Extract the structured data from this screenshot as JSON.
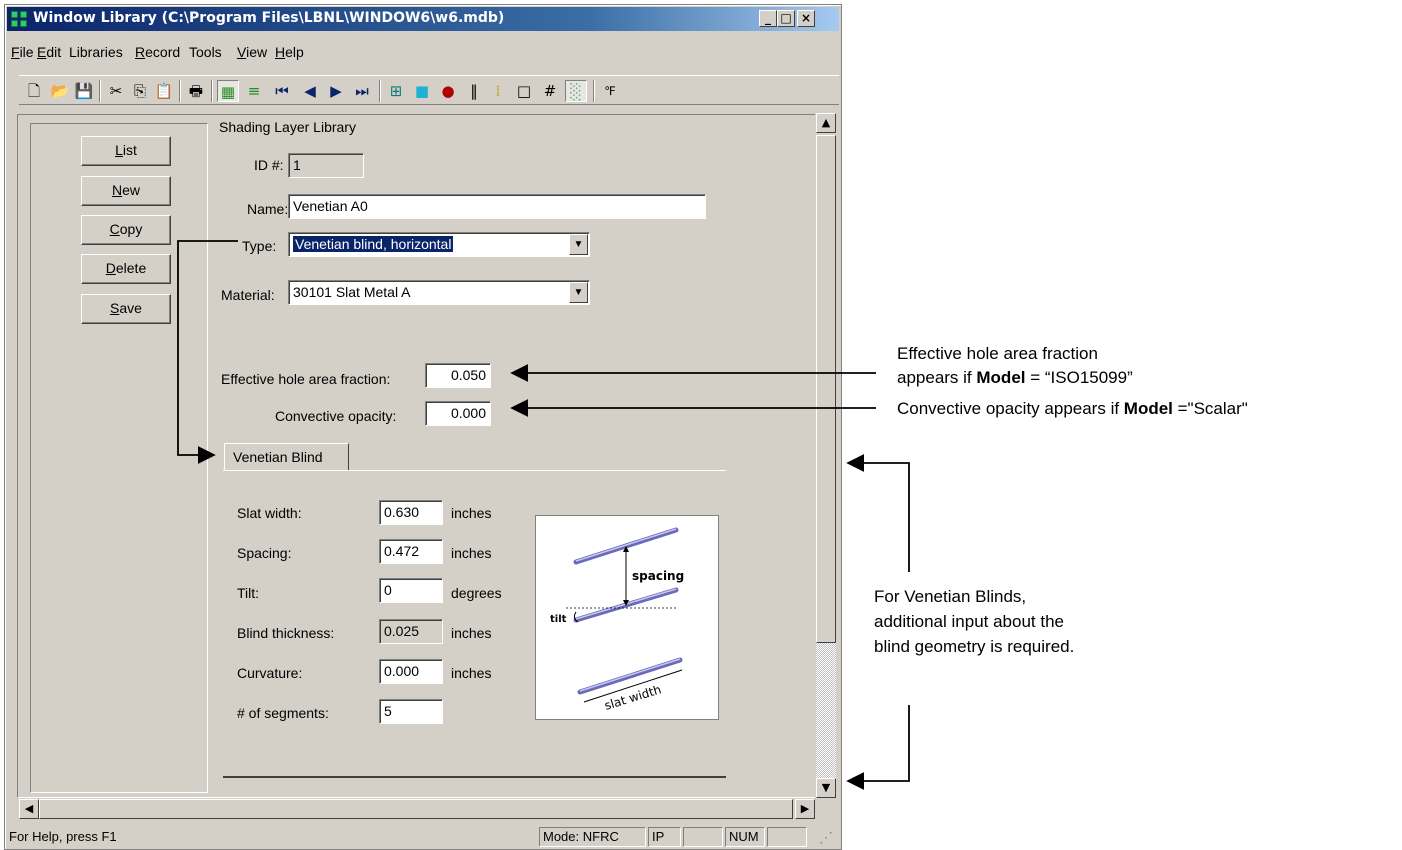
{
  "window": {
    "title": "Window Library (C:\\Program Files\\LBNL\\WINDOW6\\w6.mdb)",
    "controls": {
      "minimize": "_",
      "maximize": "□",
      "close": "×"
    }
  },
  "menu": [
    {
      "label": "File",
      "u": "F",
      "rest": "ile"
    },
    {
      "label": "Edit",
      "u": "E",
      "rest": "dit"
    },
    {
      "label": "Libraries",
      "u": "",
      "rest": "Libraries"
    },
    {
      "label": "Record",
      "u": "R",
      "rest": "ecord"
    },
    {
      "label": "Tools",
      "u": "",
      "rest": "Tools"
    },
    {
      "label": "View",
      "u": "V",
      "rest": "iew"
    },
    {
      "label": "Help",
      "u": "H",
      "rest": "elp"
    }
  ],
  "buttons": {
    "list": {
      "u": "L",
      "rest": "ist"
    },
    "new": {
      "u": "N",
      "rest": "ew"
    },
    "copy": {
      "u": "C",
      "rest": "opy"
    },
    "delete": {
      "u": "D",
      "rest": "elete"
    },
    "save": {
      "u": "S",
      "rest": "ave"
    }
  },
  "form": {
    "heading": "Shading Layer Library",
    "id_label": "ID #:",
    "id_value": "1",
    "name_label": "Name:",
    "name_value": "Venetian A0",
    "type_label": "Type:",
    "type_value": "Venetian blind, horizontal",
    "material_label": "Material:",
    "material_value": "30101 Slat Metal A",
    "hole_label": "Effective hole area fraction:",
    "hole_value": "0.050",
    "opacity_label": "Convective opacity:",
    "opacity_value": "0.000"
  },
  "tab": {
    "label": "Venetian Blind"
  },
  "blind": {
    "slat_width_label": "Slat width:",
    "slat_width_value": "0.630",
    "slat_width_unit": "inches",
    "spacing_label": "Spacing:",
    "spacing_value": "0.472",
    "spacing_unit": "inches",
    "tilt_label": "Tilt:",
    "tilt_value": "0",
    "tilt_unit": "degrees",
    "thickness_label": "Blind thickness:",
    "thickness_value": "0.025",
    "thickness_unit": "inches",
    "curvature_label": "Curvature:",
    "curvature_value": "0.000",
    "curvature_unit": "inches",
    "segments_label": "# of segments:",
    "segments_value": "5"
  },
  "diagram": {
    "spacing": "spacing",
    "tilt": "tilt",
    "slat_width": "slat width"
  },
  "status": {
    "help": "For Help, press F1",
    "mode": "Mode: NFRC",
    "units": "IP",
    "num": "NUM"
  },
  "annotations": {
    "hole_line1": "Effective hole area fraction",
    "hole_line2_pre": "appears if ",
    "hole_line2_bold": "Model",
    "hole_line2_post": " = “ISO15099”",
    "opacity_pre": "Convective opacity appears if ",
    "opacity_bold": "Model",
    "opacity_post": " =\"Scalar\"",
    "venetian_line1": "For Venetian Blinds,",
    "venetian_line2": "additional input about the",
    "venetian_line3": "blind geometry is required."
  }
}
